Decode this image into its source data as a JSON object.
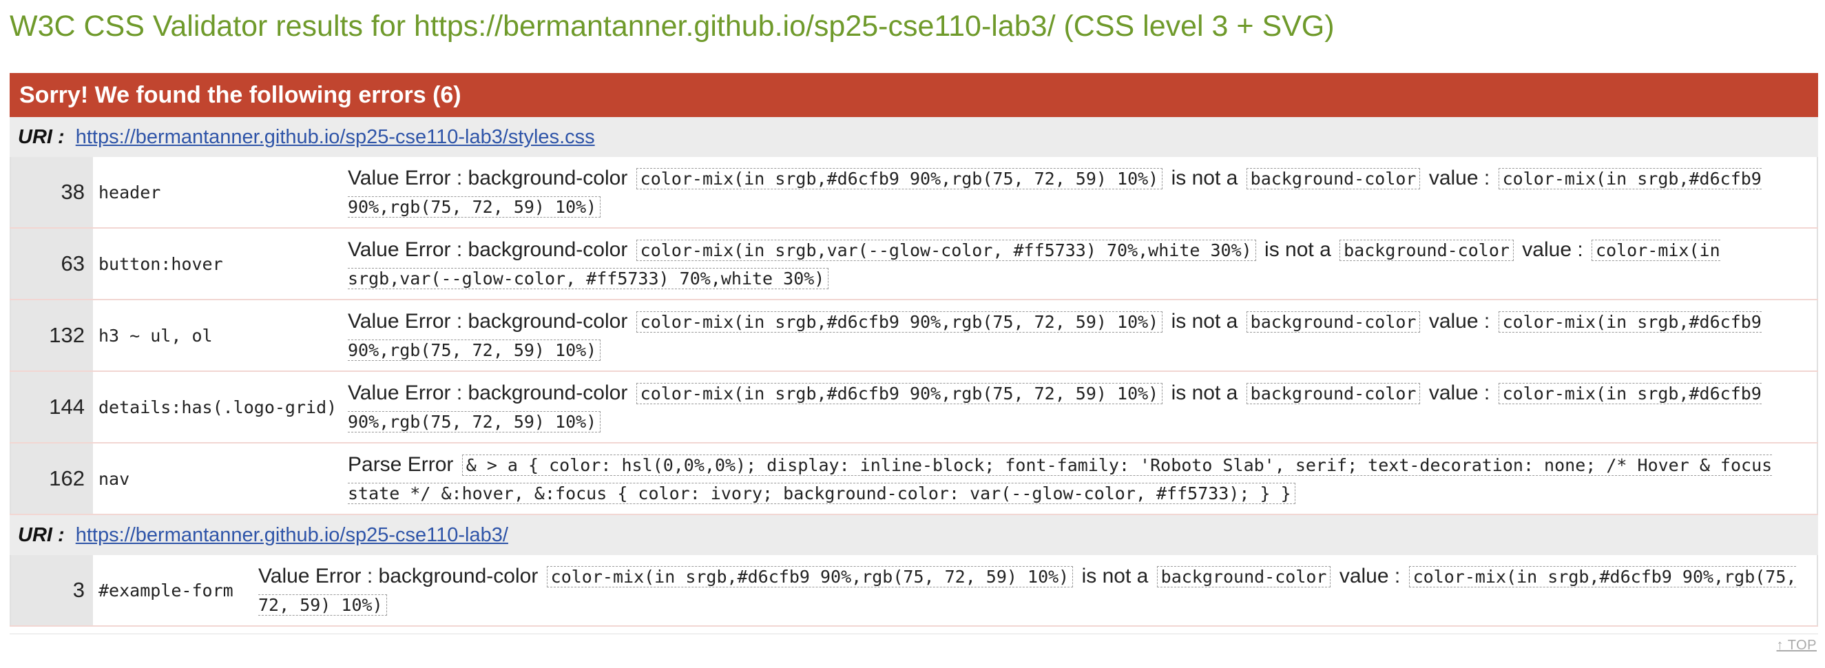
{
  "page": {
    "title": "W3C CSS Validator results for https://bermantanner.github.io/sp25-cse110-lab3/ (CSS level 3 + SVG)"
  },
  "errors_banner": "Sorry! We found the following errors (6)",
  "uri_label": "URI :",
  "groups": [
    {
      "uri": "https://bermantanner.github.io/sp25-cse110-lab3/styles.css",
      "rows": [
        {
          "line": "38",
          "context": "header",
          "error_type": "Value Error : background-color",
          "code1": "color-mix(in srgb,#d6cfb9 90%,rgb(75, 72, 59) 10%)",
          "is_not_a": "is not a",
          "code2": "background-color",
          "value_label": "value :",
          "code3": "color-mix(in srgb,#d6cfb9 90%,rgb(75, 72, 59) 10%)"
        },
        {
          "line": "63",
          "context": "button:hover",
          "error_type": "Value Error : background-color",
          "code1": "color-mix(in srgb,var(--glow-color, #ff5733) 70%,white 30%)",
          "is_not_a": "is not a",
          "code2": "background-color",
          "value_label": "value :",
          "code3": "color-mix(in srgb,var(--glow-color, #ff5733) 70%,white 30%)"
        },
        {
          "line": "132",
          "context": "h3 ~ ul, ol",
          "error_type": "Value Error : background-color",
          "code1": "color-mix(in srgb,#d6cfb9 90%,rgb(75, 72, 59) 10%)",
          "is_not_a": "is not a",
          "code2": "background-color",
          "value_label": "value :",
          "code3": "color-mix(in srgb,#d6cfb9 90%,rgb(75, 72, 59) 10%)"
        },
        {
          "line": "144",
          "context": "details:has(.logo-grid)",
          "error_type": "Value Error : background-color",
          "code1": "color-mix(in srgb,#d6cfb9 90%,rgb(75, 72, 59) 10%)",
          "is_not_a": "is not a",
          "code2": "background-color",
          "value_label": "value :",
          "code3": "color-mix(in srgb,#d6cfb9 90%,rgb(75, 72, 59) 10%)"
        },
        {
          "line": "162",
          "context": "nav",
          "error_type": "Parse Error",
          "code1": "& > a { color: hsl(0,0%,0%); display: inline-block; font-family: 'Roboto Slab', serif; text-decoration: none; /* Hover & focus state */ &:hover, &:focus { color: ivory; background-color: var(--glow-color, #ff5733); } }"
        }
      ]
    },
    {
      "uri": "https://bermantanner.github.io/sp25-cse110-lab3/",
      "rows": [
        {
          "line": "3",
          "context": "#example-form",
          "error_type": "Value Error : background-color",
          "code1": "color-mix(in srgb,#d6cfb9 90%,rgb(75, 72, 59) 10%)",
          "is_not_a": "is not a",
          "code2": "background-color",
          "value_label": "value :",
          "code3": "color-mix(in srgb,#d6cfb9 90%,rgb(75, 72, 59) 10%)"
        }
      ]
    }
  ],
  "top_link": "↑ TOP",
  "colors": {
    "title": "#6f9a2b",
    "banner": "#c1452f",
    "link": "#2e54a8"
  }
}
